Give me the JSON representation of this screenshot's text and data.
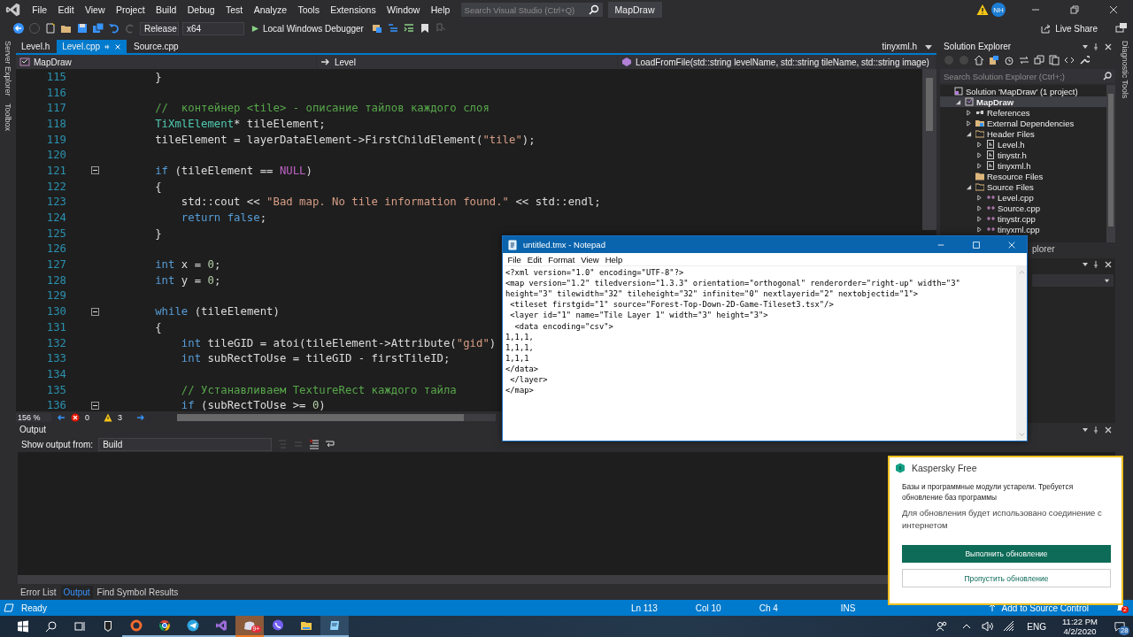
{
  "titlebar": {
    "menu": [
      "File",
      "Edit",
      "View",
      "Project",
      "Build",
      "Debug",
      "Test",
      "Analyze",
      "Tools",
      "Extensions",
      "Window",
      "Help"
    ],
    "search": {
      "placeholder": "Search Visual Studio (Ctrl+Q)"
    },
    "solution_name": "MapDraw",
    "account_initials": "NH"
  },
  "toolbar": {
    "configuration": "Release",
    "platform": "x64",
    "debugger": "Local Windows Debugger",
    "live_share": "Live Share"
  },
  "side_tabs_left": [
    "Server Explorer",
    "Toolbox"
  ],
  "side_tabs_right": [
    "Diagnostic Tools"
  ],
  "editor": {
    "tabs": [
      {
        "label": "Level.h",
        "selected": false
      },
      {
        "label": "Level.cpp",
        "selected": true
      },
      {
        "label": "Source.cpp",
        "selected": false
      }
    ],
    "overflow_tab": "tinyxml.h",
    "nav": {
      "project": "MapDraw",
      "scope": "Level",
      "member": "LoadFromFile(std::string levelName, std::string tileName, std::string image)"
    },
    "lines": [
      {
        "number": "115",
        "fold": false,
        "tokens": [
          {
            "kind": "plain",
            "text": "        }"
          }
        ]
      },
      {
        "number": "116",
        "fold": false
      },
      {
        "number": "117",
        "fold": false,
        "tokens": [
          {
            "kind": "comment",
            "text": "        //  контейнер <tile> - описание тайлов каждого слоя"
          }
        ]
      },
      {
        "number": "118",
        "fold": false,
        "tokens": [
          {
            "kind": "type",
            "text": "        TiXmlElement"
          },
          {
            "kind": "plain",
            "text": "* tileElement;"
          }
        ]
      },
      {
        "number": "119",
        "fold": false,
        "tokens": [
          {
            "kind": "plain",
            "text": "        tileElement = layerDataElement->FirstChildElement("
          },
          {
            "kind": "string",
            "text": "\"tile\""
          },
          {
            "kind": "plain",
            "text": ");"
          }
        ]
      },
      {
        "number": "120",
        "fold": false
      },
      {
        "number": "121",
        "fold": true,
        "tokens": [
          {
            "kind": "keyword",
            "text": "        if"
          },
          {
            "kind": "plain",
            "text": " (tileElement == "
          },
          {
            "kind": "macro",
            "text": "NULL"
          },
          {
            "kind": "plain",
            "text": ")"
          }
        ]
      },
      {
        "number": "122",
        "fold": false,
        "tokens": [
          {
            "kind": "plain",
            "text": "        {"
          }
        ]
      },
      {
        "number": "123",
        "fold": false,
        "tokens": [
          {
            "kind": "plain",
            "text": "            std::cout << "
          },
          {
            "kind": "string",
            "text": "\"Bad map. No tile information found.\""
          },
          {
            "kind": "plain",
            "text": " << std::endl;"
          }
        ]
      },
      {
        "number": "124",
        "fold": false,
        "tokens": [
          {
            "kind": "keyword",
            "text": "            return false"
          },
          {
            "kind": "plain",
            "text": ";"
          }
        ]
      },
      {
        "number": "125",
        "fold": false,
        "tokens": [
          {
            "kind": "plain",
            "text": "        }"
          }
        ]
      },
      {
        "number": "126",
        "fold": false
      },
      {
        "number": "127",
        "fold": false,
        "tokens": [
          {
            "kind": "keyword",
            "text": "        int"
          },
          {
            "kind": "plain",
            "text": " x = "
          },
          {
            "kind": "number",
            "text": "0"
          },
          {
            "kind": "plain",
            "text": ";"
          }
        ]
      },
      {
        "number": "128",
        "fold": false,
        "tokens": [
          {
            "kind": "keyword",
            "text": "        int"
          },
          {
            "kind": "plain",
            "text": " y = "
          },
          {
            "kind": "number",
            "text": "0"
          },
          {
            "kind": "plain",
            "text": ";"
          }
        ]
      },
      {
        "number": "129",
        "fold": false
      },
      {
        "number": "130",
        "fold": true,
        "tokens": [
          {
            "kind": "keyword",
            "text": "        while"
          },
          {
            "kind": "plain",
            "text": " (tileElement)"
          }
        ]
      },
      {
        "number": "131",
        "fold": false,
        "tokens": [
          {
            "kind": "plain",
            "text": "        {"
          }
        ]
      },
      {
        "number": "132",
        "fold": false,
        "tokens": [
          {
            "kind": "keyword",
            "text": "            int"
          },
          {
            "kind": "plain",
            "text": " tileGID = atoi(tileElement->Attribute("
          },
          {
            "kind": "string",
            "text": "\"gid\""
          },
          {
            "kind": "plain",
            "text": ")"
          }
        ]
      },
      {
        "number": "133",
        "fold": false,
        "tokens": [
          {
            "kind": "keyword",
            "text": "            int"
          },
          {
            "kind": "plain",
            "text": " subRectToUse = tileGID - firstTileID;"
          }
        ]
      },
      {
        "number": "134",
        "fold": false
      },
      {
        "number": "135",
        "fold": false,
        "tokens": [
          {
            "kind": "comment",
            "text": "            // Устанавливаем TextureRect каждого тайла"
          }
        ]
      },
      {
        "number": "136",
        "fold": true,
        "tokens": [
          {
            "kind": "keyword",
            "text": "            if"
          },
          {
            "kind": "plain",
            "text": " (subRectToUse >= "
          },
          {
            "kind": "number",
            "text": "0"
          },
          {
            "kind": "plain",
            "text": ")"
          }
        ]
      }
    ],
    "zoom": "156 %",
    "errors": "0",
    "warnings": "3"
  },
  "solution_explorer": {
    "title": "Solution Explorer",
    "search": {
      "placeholder": "Search Solution Explorer (Ctrl+;)"
    },
    "tree": [
      {
        "label": "Solution 'MapDraw' (1 project)",
        "kind": "solution",
        "selected": false,
        "children": [
          {
            "label": "MapDraw",
            "kind": "project",
            "selected": true,
            "expanded": true,
            "children": [
              {
                "label": "References",
                "kind": "references",
                "selected": false,
                "expanded": false
              },
              {
                "label": "External Dependencies",
                "kind": "dependencies",
                "selected": false,
                "expanded": false
              },
              {
                "label": "Header Files",
                "kind": "folder",
                "selected": false,
                "expanded": true,
                "children": [
                  {
                    "label": "Level.h",
                    "kind": "header",
                    "selected": false,
                    "expanded": false
                  },
                  {
                    "label": "tinystr.h",
                    "kind": "header",
                    "selected": false,
                    "expanded": false
                  },
                  {
                    "label": "tinyxml.h",
                    "kind": "header",
                    "selected": false,
                    "expanded": false
                  }
                ]
              },
              {
                "label": "Resource Files",
                "kind": "folder",
                "selected": false
              },
              {
                "label": "Source Files",
                "kind": "folder",
                "selected": false,
                "expanded": true,
                "children": [
                  {
                    "label": "Level.cpp",
                    "kind": "cpp",
                    "selected": false,
                    "expanded": false
                  },
                  {
                    "label": "Source.cpp",
                    "kind": "cpp",
                    "selected": false,
                    "expanded": false
                  },
                  {
                    "label": "tinystr.cpp",
                    "kind": "cpp",
                    "selected": false,
                    "expanded": false
                  },
                  {
                    "label": "tinyxml.cpp",
                    "kind": "cpp",
                    "selected": false,
                    "expanded": false
                  }
                ]
              }
            ]
          }
        ]
      }
    ],
    "tab": "plorer"
  },
  "output": {
    "title": "Output",
    "source_label": "Show output from:",
    "source": "Build"
  },
  "bottom_tabs": [
    {
      "label": "Error List",
      "selected": false
    },
    {
      "label": "Output",
      "selected": true
    },
    {
      "label": "Find Symbol Results",
      "selected": false
    }
  ],
  "status_bar": {
    "state": "Ready",
    "line": "Ln 113",
    "column": "Col 10",
    "char": "Ch 4",
    "mode": "INS",
    "source_control": "Add to Source Control",
    "notifications": "2"
  },
  "notepad": {
    "title": "untitled.tmx - Notepad",
    "menu": [
      "File",
      "Edit",
      "Format",
      "View",
      "Help"
    ],
    "lines": [
      "<?xml version=\"1.0\" encoding=\"UTF-8\"?>",
      "<map version=\"1.2\" tiledversion=\"1.3.3\" orientation=\"orthogonal\" renderorder=\"right-up\" width=\"3\"",
      "height=\"3\" tilewidth=\"32\" tileheight=\"32\" infinite=\"0\" nextlayerid=\"2\" nextobjectid=\"1\">",
      " <tileset firstgid=\"1\" source=\"Forest-Top-Down-2D-Game-Tileset3.tsx\"/>",
      " <layer id=\"1\" name=\"Tile Layer 1\" width=\"3\" height=\"3\">",
      "  <data encoding=\"csv\">",
      "1,1,1,",
      "1,1,1,",
      "1,1,1",
      "</data>",
      " </layer>",
      "</map>"
    ]
  },
  "toast": {
    "app": "Kaspersky Free",
    "headline": "Базы и программные модули устарели. Требуется обновление баз программы",
    "body": "Для обновления будет использовано соединение с интернетом",
    "primary": "Выполнить обновление",
    "secondary": "Пропустить обновление"
  },
  "taskbar": {
    "badge": "9+",
    "language": "ENG",
    "time": "11:22 PM",
    "date": "4/2/2020",
    "notifications": "28"
  }
}
